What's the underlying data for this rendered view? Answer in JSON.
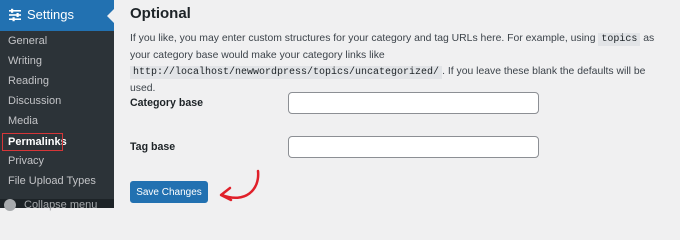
{
  "sidebar": {
    "header_label": "Settings",
    "items": [
      {
        "label": "General"
      },
      {
        "label": "Writing"
      },
      {
        "label": "Reading"
      },
      {
        "label": "Discussion"
      },
      {
        "label": "Media"
      },
      {
        "label": "Permalinks",
        "active": true
      },
      {
        "label": "Privacy"
      },
      {
        "label": "File Upload Types"
      }
    ],
    "collapse_label": "Collapse menu"
  },
  "main": {
    "section_title": "Optional",
    "description": {
      "part1": "If you like, you may enter custom structures for your category and tag URLs here. For example, using ",
      "code1": "topics",
      "part2": " as your category base would make your category links like ",
      "code2": "http://localhost/newwordpress/topics/uncategorized/",
      "part3": ". If you leave these blank the defaults will be used."
    },
    "fields": {
      "category_base": {
        "label": "Category base",
        "value": ""
      },
      "tag_base": {
        "label": "Tag base",
        "value": ""
      }
    },
    "save_button": "Save Changes"
  },
  "colors": {
    "sidebar_bg": "#1d2327",
    "accent": "#2271b1",
    "highlight_box": "#d63638",
    "annotation_arrow": "#e0202a"
  },
  "icons": {
    "settings": "settings-sliders-icon",
    "collapse": "collapse-menu-icon",
    "annotation": "curved-arrow-icon"
  }
}
